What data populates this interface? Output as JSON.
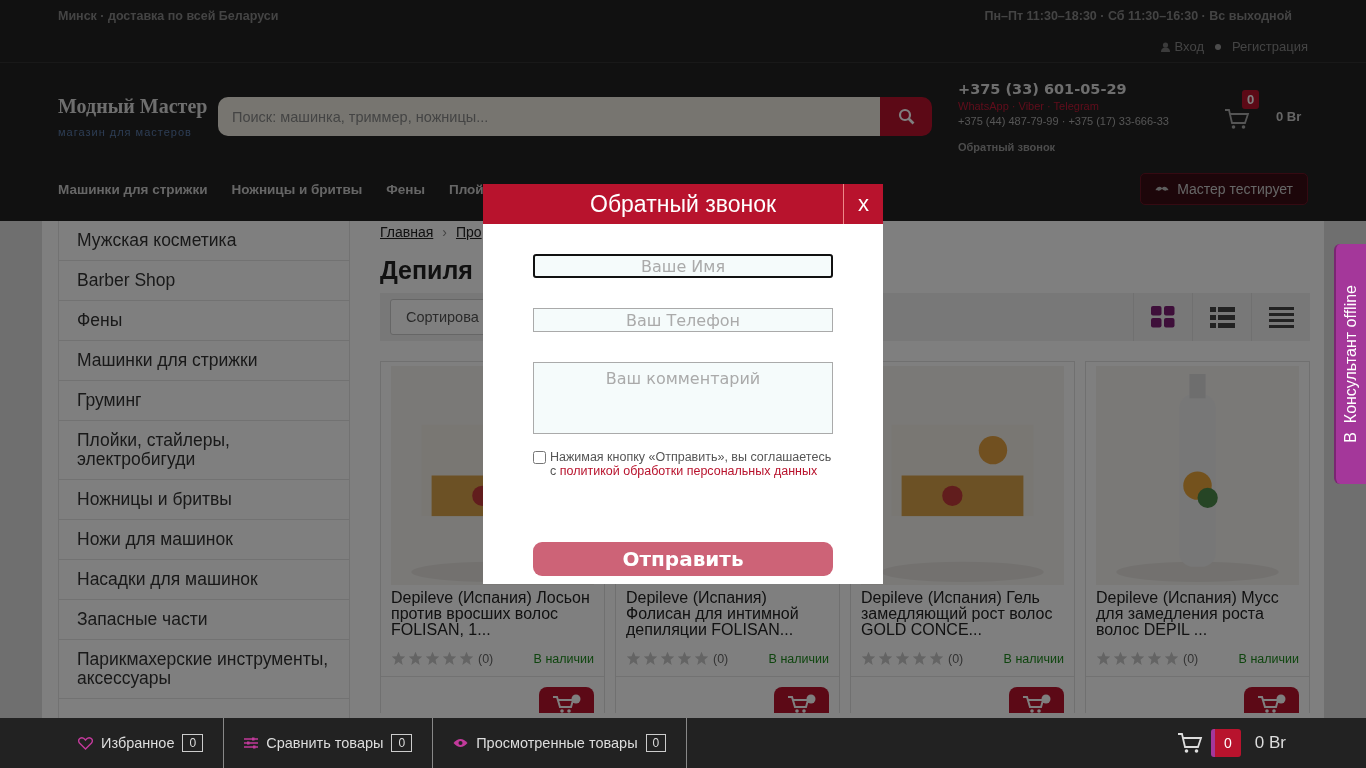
{
  "top_bar": {
    "location": "Минск · доставка по всей Беларуси",
    "hours": "Пн–Пт 11:30–18:30 · Сб 11:30–16:30 · Вс выходной",
    "login": "Вход",
    "register": "Регистрация"
  },
  "header": {
    "logo": "Модный Мастер",
    "tagline": "магазин для мастеров",
    "search": {
      "placeholder": "Поиск: машинка, триммер, ножницы..."
    },
    "phone": "+375 (33) 601-05-29",
    "messengers": "WhatsApp · Viber · Telegram",
    "phones_more": "+375 (44) 487-79-99 · +375 (17) 33-666-33",
    "callback": "Обратный звонок",
    "cart": {
      "count": "0",
      "total": "0 Br"
    }
  },
  "nav": {
    "items": [
      "Машинки для стрижки",
      "Ножницы и бритвы",
      "Фены",
      "Плой"
    ],
    "promo": "Мастер тестирует"
  },
  "sidebar": {
    "items": [
      "Мужская косметика",
      "Barber Shop",
      "Фены",
      "Машинки для стрижки",
      "Груминг",
      "Плойки, стайлеры, электробигуди",
      "Ножницы и бритвы",
      "Ножи для машинок",
      "Насадки для машинок",
      "Запасные части",
      "Парикмахерские инструменты, аксессуары"
    ]
  },
  "breadcrumb": {
    "items": [
      "Главная",
      "Про"
    ],
    "separator": "›"
  },
  "heading": "Депиля",
  "toolbar": {
    "sort": "Сортирова",
    "views": [
      {
        "kind": "grid",
        "selected": true
      },
      {
        "kind": "list",
        "selected": false
      },
      {
        "kind": "table",
        "selected": false
      }
    ]
  },
  "products": [
    {
      "title": "Depileve (Испания) Лосьон против вросших волос FOLISAN, 1...",
      "stars": 0,
      "reviews": "(0)",
      "availability": "В наличии"
    },
    {
      "title": "Depileve (Испания) Фолисан для интимной депиляции FOLISAN...",
      "stars": 0,
      "reviews": "(0)",
      "availability": "В наличии"
    },
    {
      "title": "Depileve (Испания) Гель замедляющий рост волос GOLD CONCE...",
      "stars": 0,
      "reviews": "(0)",
      "availability": "В наличии"
    },
    {
      "title": "Depileve (Испания) Мусс для замедления роста волос DEPIL ...",
      "stars": 0,
      "reviews": "(0)",
      "availability": "В наличии"
    }
  ],
  "consultant": "В  Консультант offline",
  "bottom_bar": {
    "items": [
      {
        "kind": "favorites",
        "label": "Избранное",
        "count": "0"
      },
      {
        "kind": "compare",
        "label": "Сравнить товары",
        "count": "0"
      },
      {
        "kind": "viewed",
        "label": "Просмотренные товары",
        "count": "0"
      }
    ],
    "cart_count": "0",
    "cart_total": "0 Br"
  },
  "modal": {
    "title": "Обратный звонок",
    "close": "x",
    "fields": [
      {
        "kind": "input",
        "placeholder": "Ваше Имя",
        "focused": true
      },
      {
        "kind": "input",
        "placeholder": "Ваш Телефон",
        "focused": false
      },
      {
        "kind": "textarea",
        "placeholder": "Ваш комментарий",
        "focused": false
      }
    ],
    "consent": {
      "checked": false,
      "text": "Нажимая кнопку «Отправить», вы соглашаетесь с ",
      "link": "политикой обработки персональных данных"
    },
    "submit": "Отправить"
  }
}
